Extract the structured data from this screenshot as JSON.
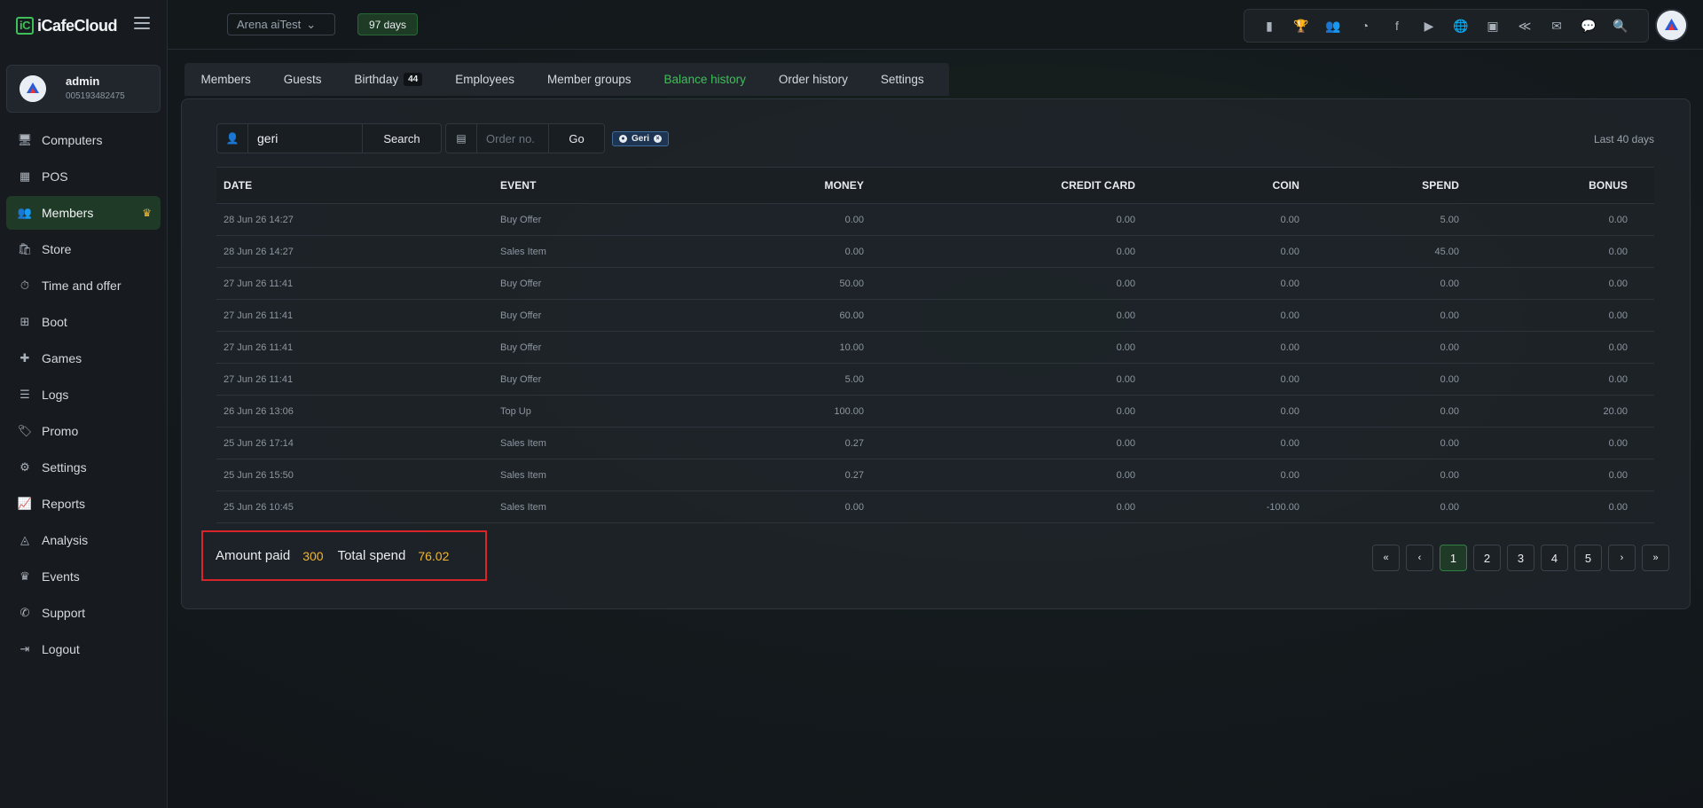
{
  "app": {
    "name": "iCafeCloud",
    "logo_mark": "iC"
  },
  "user": {
    "name": "admin",
    "id": "005193482475"
  },
  "nav": [
    {
      "label": "Computers",
      "icon": "monitor-icon",
      "glyph": "🖥"
    },
    {
      "label": "POS",
      "icon": "cash-register-icon",
      "glyph": "▦"
    },
    {
      "label": "Members",
      "icon": "users-icon",
      "glyph": "👥",
      "badge": "♛"
    },
    {
      "label": "Store",
      "icon": "shopping-bag-icon",
      "glyph": "🛍"
    },
    {
      "label": "Time and offer",
      "icon": "stopwatch-icon",
      "glyph": "⏱"
    },
    {
      "label": "Boot",
      "icon": "windows-icon",
      "glyph": "⊞"
    },
    {
      "label": "Games",
      "icon": "gamepad-icon",
      "glyph": "✚"
    },
    {
      "label": "Logs",
      "icon": "list-icon",
      "glyph": "☰"
    },
    {
      "label": "Promo",
      "icon": "tag-icon",
      "glyph": "🏷"
    },
    {
      "label": "Settings",
      "icon": "gear-icon",
      "glyph": "⚙"
    },
    {
      "label": "Reports",
      "icon": "line-chart-icon",
      "glyph": "📈"
    },
    {
      "label": "Analysis",
      "icon": "area-chart-icon",
      "glyph": "◬"
    },
    {
      "label": "Events",
      "icon": "crown-icon",
      "glyph": "♛"
    },
    {
      "label": "Support",
      "icon": "phone-icon",
      "glyph": "✆"
    },
    {
      "label": "Logout",
      "icon": "logout-icon",
      "glyph": "⇥"
    }
  ],
  "topbar": {
    "store": "Arena aiTest",
    "days": "97 days",
    "tools": [
      {
        "icon": "leaderboard-icon",
        "glyph": "▮"
      },
      {
        "icon": "trophy-icon",
        "glyph": "🏆"
      },
      {
        "icon": "users-group-icon",
        "glyph": "👥"
      },
      {
        "icon": "rss-icon",
        "glyph": "◔"
      },
      {
        "icon": "facebook-icon",
        "glyph": "f"
      },
      {
        "icon": "youtube-icon",
        "glyph": "▶"
      },
      {
        "icon": "globe-icon",
        "glyph": "🌐"
      },
      {
        "icon": "icafe-logo-icon",
        "glyph": "▣"
      },
      {
        "icon": "handshake-icon",
        "glyph": "≪"
      },
      {
        "icon": "envelope-icon",
        "glyph": "✉"
      },
      {
        "icon": "chat-icon",
        "glyph": "💬"
      },
      {
        "icon": "search-icon",
        "glyph": "🔍"
      }
    ]
  },
  "tabs": [
    {
      "label": "Members"
    },
    {
      "label": "Guests"
    },
    {
      "label": "Birthday",
      "count": "44"
    },
    {
      "label": "Employees"
    },
    {
      "label": "Member groups"
    },
    {
      "label": "Balance history",
      "active": true
    },
    {
      "label": "Order history"
    },
    {
      "label": "Settings"
    }
  ],
  "search": {
    "value": "geri",
    "placeholder": "",
    "button": "Search"
  },
  "order": {
    "placeholder": "Order no.",
    "button": "Go"
  },
  "filter_chip": {
    "label": "Geri"
  },
  "range_label": "Last 40 days",
  "table": {
    "headers": [
      "DATE",
      "EVENT",
      "MONEY",
      "CREDIT CARD",
      "COIN",
      "SPEND",
      "BONUS"
    ],
    "rows": [
      [
        "28 Jun 26 14:27",
        "Buy Offer",
        "0.00",
        "0.00",
        "0.00",
        "5.00",
        "0.00"
      ],
      [
        "28 Jun 26 14:27",
        "Sales Item",
        "0.00",
        "0.00",
        "0.00",
        "45.00",
        "0.00"
      ],
      [
        "27 Jun 26 11:41",
        "Buy Offer",
        "50.00",
        "0.00",
        "0.00",
        "0.00",
        "0.00"
      ],
      [
        "27 Jun 26 11:41",
        "Buy Offer",
        "60.00",
        "0.00",
        "0.00",
        "0.00",
        "0.00"
      ],
      [
        "27 Jun 26 11:41",
        "Buy Offer",
        "10.00",
        "0.00",
        "0.00",
        "0.00",
        "0.00"
      ],
      [
        "27 Jun 26 11:41",
        "Buy Offer",
        "5.00",
        "0.00",
        "0.00",
        "0.00",
        "0.00"
      ],
      [
        "26 Jun 26 13:06",
        "Top Up",
        "100.00",
        "0.00",
        "0.00",
        "0.00",
        "20.00"
      ],
      [
        "25 Jun 26 17:14",
        "Sales Item",
        "0.27",
        "0.00",
        "0.00",
        "0.00",
        "0.00"
      ],
      [
        "25 Jun 26 15:50",
        "Sales Item",
        "0.27",
        "0.00",
        "0.00",
        "0.00",
        "0.00"
      ],
      [
        "25 Jun 26 10:45",
        "Sales Item",
        "0.00",
        "0.00",
        "-100.00",
        "0.00",
        "0.00"
      ]
    ]
  },
  "summary": {
    "amount_paid_label": "Amount paid",
    "amount_paid": "300",
    "total_spend_label": "Total spend",
    "total_spend": "76.02"
  },
  "pager": {
    "first": "«",
    "prev": "‹",
    "pages": [
      "1",
      "2",
      "3",
      "4",
      "5"
    ],
    "active": "1",
    "next": "›",
    "last": "»"
  },
  "colors": {
    "accent": "#3fbf5a",
    "highlight": "#f2b632",
    "summary_border": "#d9252a"
  }
}
